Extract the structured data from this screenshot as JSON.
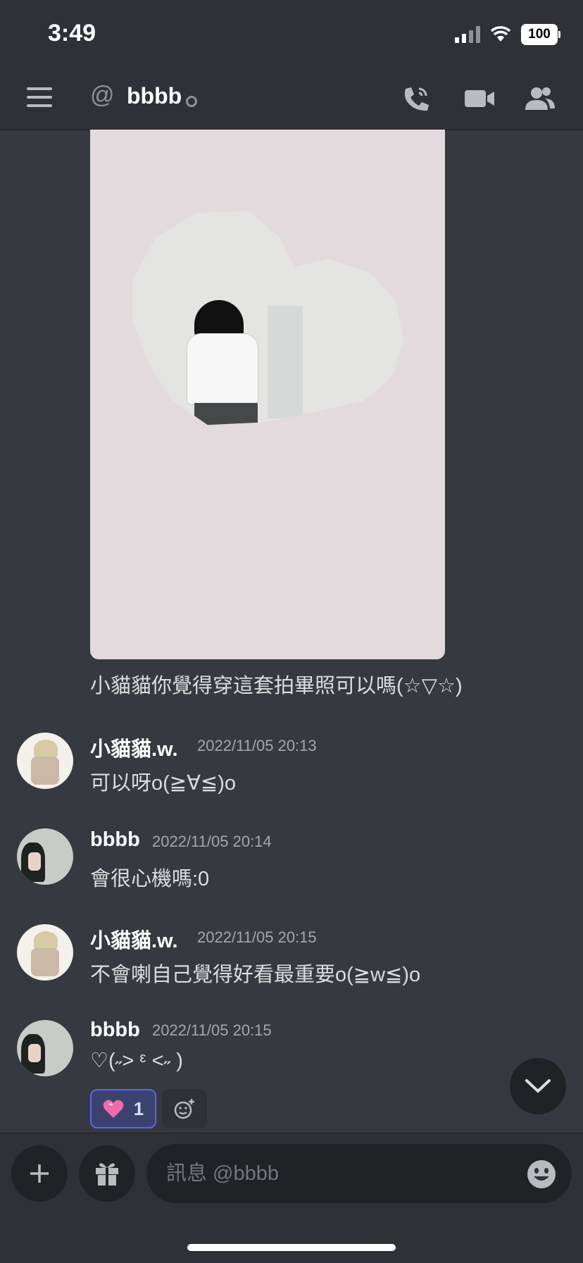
{
  "status_bar": {
    "time": "3:49",
    "battery": "100"
  },
  "header": {
    "channel_name": "bbbb",
    "icons": [
      "menu-icon",
      "at-icon",
      "call-icon",
      "video-icon",
      "members-icon"
    ]
  },
  "caption": "小貓貓你覺得穿這套拍畢照可以嗎(☆▽☆)",
  "messages": [
    {
      "author": "小貓貓.w.",
      "timestamp": "2022/11/05 20:13",
      "text": "可以呀o(≧∀≦)o"
    },
    {
      "author": "bbbb",
      "timestamp": "2022/11/05 20:14",
      "text": "會很心機嗎:0"
    },
    {
      "author": "小貓貓.w.",
      "timestamp": "2022/11/05 20:15",
      "text": "不會喇自己覺得好看最重要o(≧w≦)o"
    },
    {
      "author": "bbbb",
      "timestamp": "2022/11/05 20:15",
      "text": "♡(˶˃ ᵋ ˂˶ )"
    }
  ],
  "reaction": {
    "emoji": "heart-emoji",
    "count": "1"
  },
  "composer": {
    "placeholder": "訊息 @bbbb"
  },
  "colors": {
    "background": "#36393f",
    "bar": "#2f3136",
    "accent": "#5865f2"
  }
}
